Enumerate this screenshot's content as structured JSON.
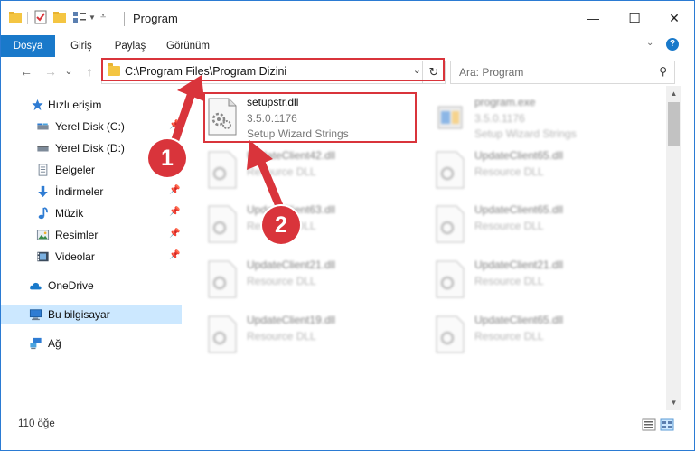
{
  "window": {
    "title": "Program",
    "controls": {
      "minimize": "—",
      "maximize": "☐",
      "close": "✕"
    }
  },
  "ribbon": {
    "tabs": [
      {
        "label": "Dosya",
        "active": true
      },
      {
        "label": "Giriş"
      },
      {
        "label": "Paylaş"
      },
      {
        "label": "Görünüm"
      }
    ],
    "help": "?"
  },
  "nav": {
    "back": "←",
    "forward": "→",
    "recent": "⌄",
    "up": "↑",
    "address": "C:\\Program Files\\Program Dizini",
    "search_placeholder": "Ara: Program"
  },
  "sidebar": {
    "items": [
      {
        "label": "Hızlı erişim",
        "icon": "star-icon"
      },
      {
        "label": "Yerel Disk (C:)",
        "icon": "drive-icon",
        "pinned": true
      },
      {
        "label": "Yerel Disk (D:)",
        "icon": "drive-icon"
      },
      {
        "label": "Belgeler",
        "icon": "documents-icon",
        "pinned": true
      },
      {
        "label": "İndirmeler",
        "icon": "download-icon",
        "pinned": true
      },
      {
        "label": "Müzik",
        "icon": "music-icon",
        "pinned": true
      },
      {
        "label": "Resimler",
        "icon": "pictures-icon",
        "pinned": true
      },
      {
        "label": "Videolar",
        "icon": "videos-icon",
        "pinned": true
      },
      {
        "label": "OneDrive",
        "icon": "cloud-icon"
      },
      {
        "label": "Bu bilgisayar",
        "icon": "computer-icon",
        "selected": true
      },
      {
        "label": "Ağ",
        "icon": "network-icon"
      }
    ]
  },
  "files": {
    "highlighted": {
      "name": "setupstr.dll",
      "version": "3.5.0.1176",
      "description": "Setup Wizard Strings"
    },
    "others": [
      {
        "name": "program.exe",
        "version": "3.5.0.1176",
        "description": "Setup Wizard Strings"
      },
      {
        "name": "UpdateClient42.dll",
        "description": "Resource DLL"
      },
      {
        "name": "UpdateClient65.dll",
        "description": "Resource DLL"
      },
      {
        "name": "UpdateClient63.dll",
        "description": "Resource DLL"
      },
      {
        "name": "UpdateClient65.dll",
        "description": "Resource DLL"
      },
      {
        "name": "UpdateClient21.dll",
        "description": "Resource DLL"
      },
      {
        "name": "UpdateClient21.dll",
        "description": "Resource DLL"
      },
      {
        "name": "UpdateClient19.dll",
        "description": "Resource DLL"
      },
      {
        "name": "UpdateClient65.dll",
        "description": "Resource DLL"
      }
    ]
  },
  "status": {
    "count": "110 öğe"
  },
  "callouts": {
    "one": "1",
    "two": "2"
  },
  "colors": {
    "accent": "#1979ca",
    "highlight": "#d9343b",
    "selected": "#cce8ff"
  }
}
